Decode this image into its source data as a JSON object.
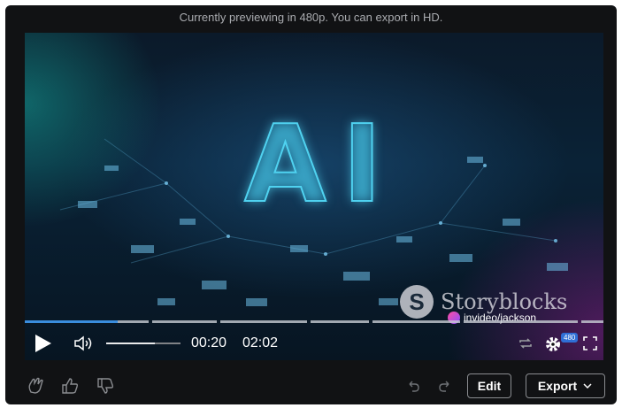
{
  "banner": {
    "text": "Currently previewing in 480p. You can export in HD."
  },
  "video": {
    "title_art": "AI",
    "watermark": "Storyblocks",
    "watermark_logo": "S",
    "credit": "invideo/jackson"
  },
  "player": {
    "current_time": "00:20",
    "duration": "02:02",
    "progress_fraction": 0.16,
    "volume_fraction": 0.65,
    "quality_badge": "480",
    "icons": [
      "play-icon",
      "volume-icon",
      "loop-icon",
      "settings-icon",
      "fullscreen-icon"
    ]
  },
  "toolbar": {
    "edit_label": "Edit",
    "export_label": "Export",
    "icons": [
      "clap-icon",
      "thumbs-up-icon",
      "thumbs-down-icon",
      "undo-icon",
      "redo-icon",
      "chevron-down-icon"
    ]
  },
  "colors": {
    "frame_bg": "#111214",
    "accent_blue": "#3a8dde",
    "glow_cyan": "#4fd2f0"
  }
}
